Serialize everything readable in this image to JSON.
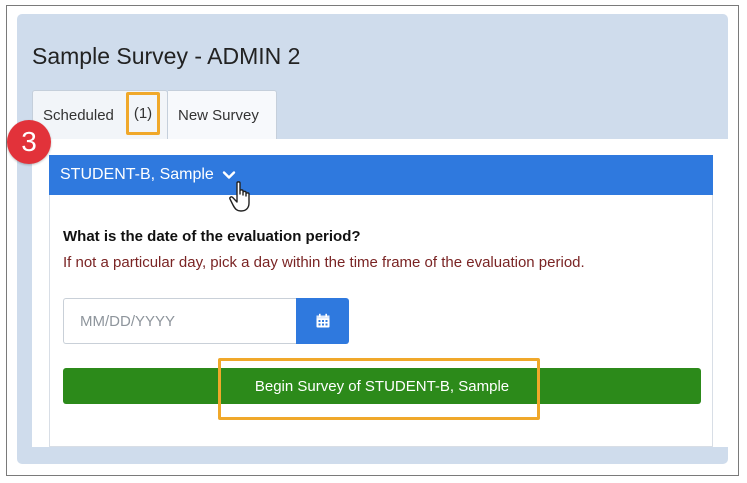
{
  "page": {
    "title": "Sample Survey - ADMIN 2"
  },
  "tabs": [
    {
      "label": "Scheduled",
      "count": "(1)"
    },
    {
      "label": "New Survey"
    }
  ],
  "step_badge": "3",
  "student": {
    "name": "STUDENT-B, Sample"
  },
  "form": {
    "question": "What is the date of the evaluation period?",
    "hint": "If not a particular day, pick a day within the time frame of the evaluation period.",
    "date_placeholder": "MM/DD/YYYY"
  },
  "actions": {
    "begin_label": "Begin Survey of STUDENT-B, Sample"
  },
  "colors": {
    "accent_blue": "#2f79de",
    "success_green": "#2c8a1a",
    "highlight_orange": "#f0a82a",
    "badge_red": "#e2323a",
    "panel_bg": "#cfdcec"
  },
  "icons": {
    "dropdown": "chevron-down-icon",
    "calendar": "calendar-icon",
    "cursor": "hand-pointer-icon"
  }
}
